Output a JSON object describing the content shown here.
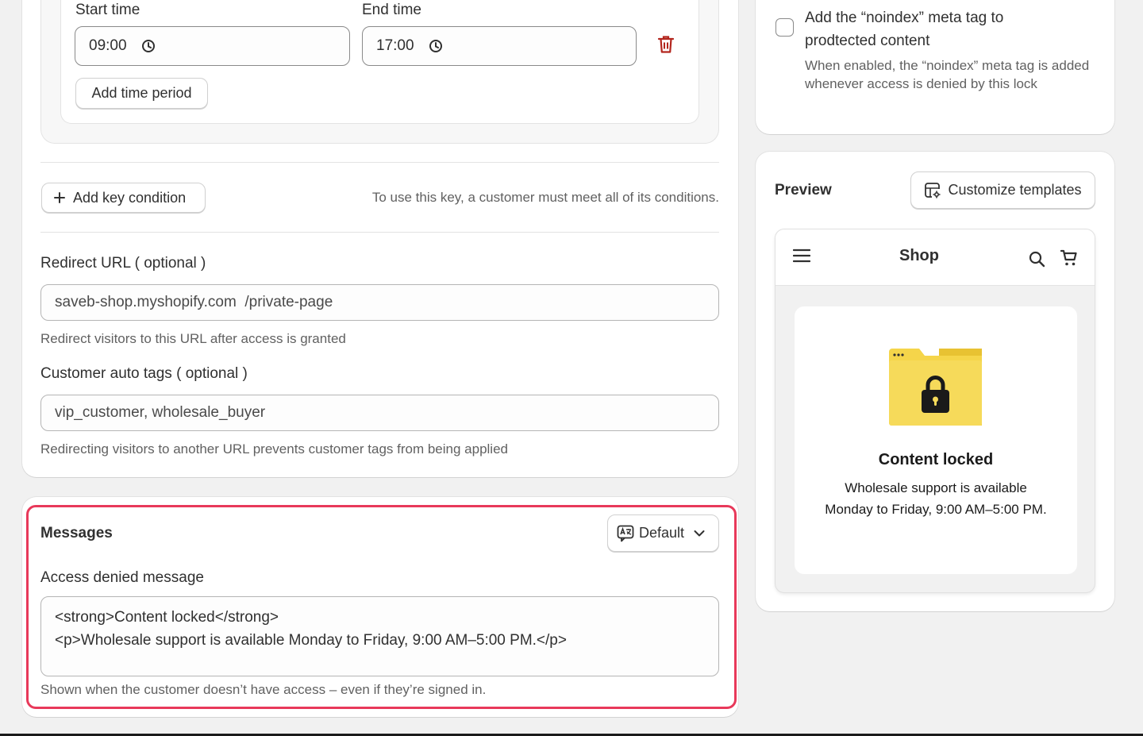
{
  "schedule": {
    "start_label": "Start time",
    "end_label": "End time",
    "start_value": "09:00",
    "end_value": "17:00",
    "add_period_label": "Add time period"
  },
  "conditions": {
    "add_key_label": "Add key condition",
    "note": "To use this key, a customer must meet all of its conditions."
  },
  "redirect": {
    "label": "Redirect URL ( optional )",
    "value": "saveb-shop.myshopify.com  /private-page",
    "help": "Redirect visitors to this URL after access is granted"
  },
  "auto_tags": {
    "label": "Customer auto tags ( optional )",
    "value": "vip_customer, wholesale_buyer",
    "help": "Redirecting visitors to another URL prevents customer tags from being applied"
  },
  "messages": {
    "title": "Messages",
    "language_select": "Default",
    "access_denied_label": "Access denied message",
    "access_denied_line1": "<strong>Content locked</strong>",
    "access_denied_line2": "<p>Wholesale support is available Monday to Friday, 9:00 AM–5:00 PM.</p>",
    "help": "Shown when the customer doesn’t have access – even if they’re signed in.",
    "highlight_color": "#e8395a"
  },
  "seo": {
    "noindex_label_line1": "Add the “noindex” meta tag to",
    "noindex_label_line2": "prodtected content",
    "noindex_help": "When enabled, the “noindex” meta tag is added whenever access is denied by this lock",
    "noindex_checked": false
  },
  "preview": {
    "title": "Preview",
    "customize_label": "Customize templates",
    "shop_title": "Shop",
    "locked_title": "Content locked",
    "locked_text": "Wholesale support is available Monday to Friday, 9:00 AM–5:00 PM.",
    "folder_color": "#f5d54a"
  },
  "icons": [
    "clock-icon",
    "trash-icon",
    "plus-icon",
    "translate-icon",
    "chevron-down-icon",
    "customize-icon",
    "menu-icon",
    "search-icon",
    "cart-icon",
    "folder-lock-icon"
  ]
}
